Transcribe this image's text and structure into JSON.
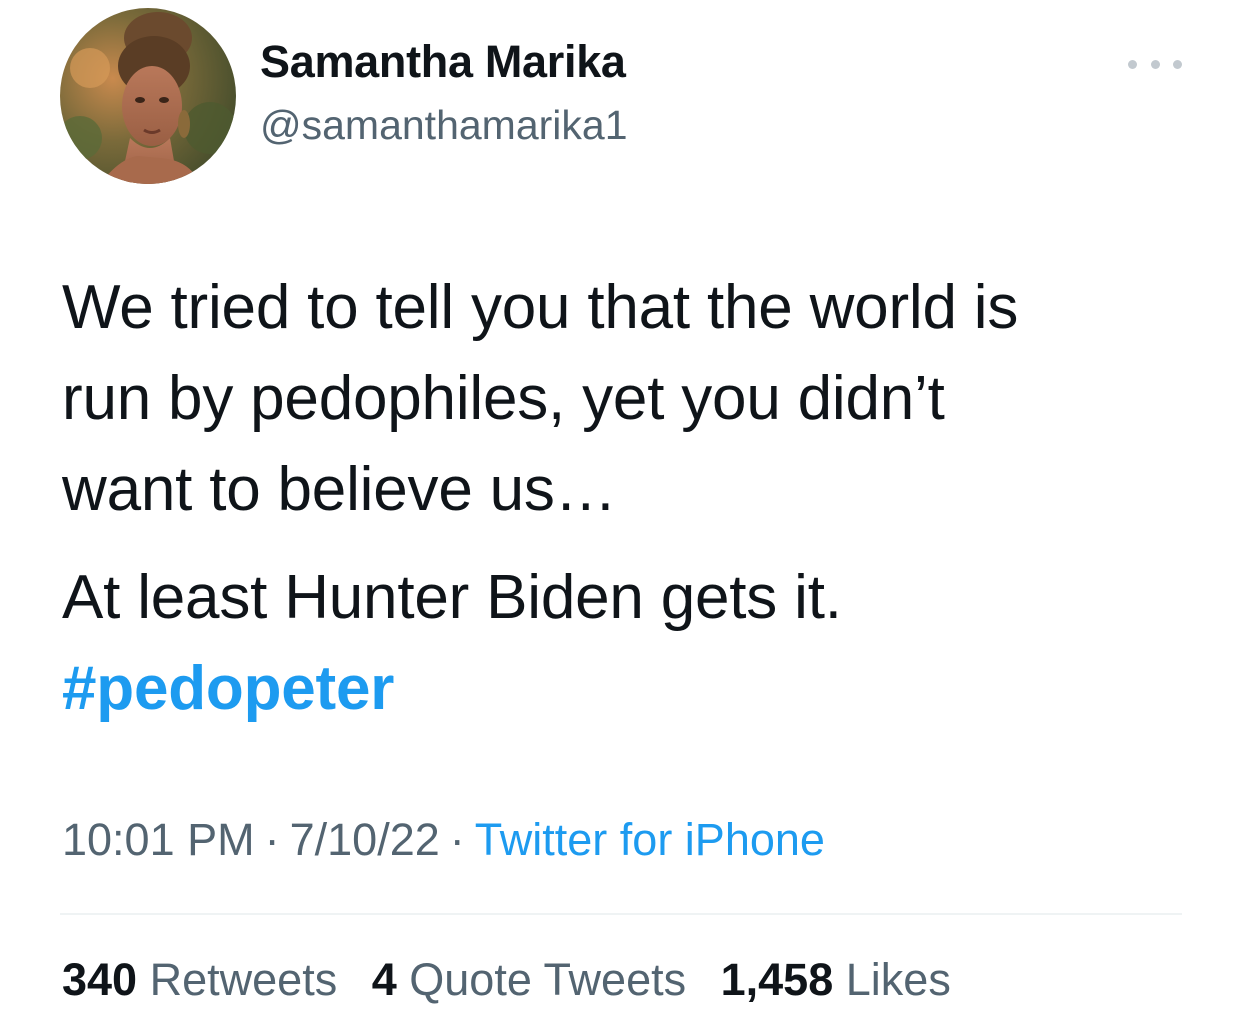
{
  "author": {
    "display_name": "Samantha Marika",
    "handle": "@samanthamarika1"
  },
  "tweet": {
    "paragraphs": [
      "We tried to tell you that the world is",
      "run by pedophiles, yet you didn’t",
      "want to believe us…"
    ],
    "second_paragraph": "At least Hunter Biden gets it.",
    "hashtag": "#pedopeter"
  },
  "meta": {
    "time": "10:01 PM",
    "separator": "·",
    "date": "7/10/22",
    "source": "Twitter for iPhone"
  },
  "stats": {
    "retweets_count": "340",
    "retweets_label": "Retweets",
    "quotes_count": "4",
    "quotes_label": "Quote Tweets",
    "likes_count": "1,458",
    "likes_label": "Likes"
  },
  "colors": {
    "link": "#1d9bf0",
    "secondary_text": "#536471",
    "primary_text": "#0f1419"
  }
}
